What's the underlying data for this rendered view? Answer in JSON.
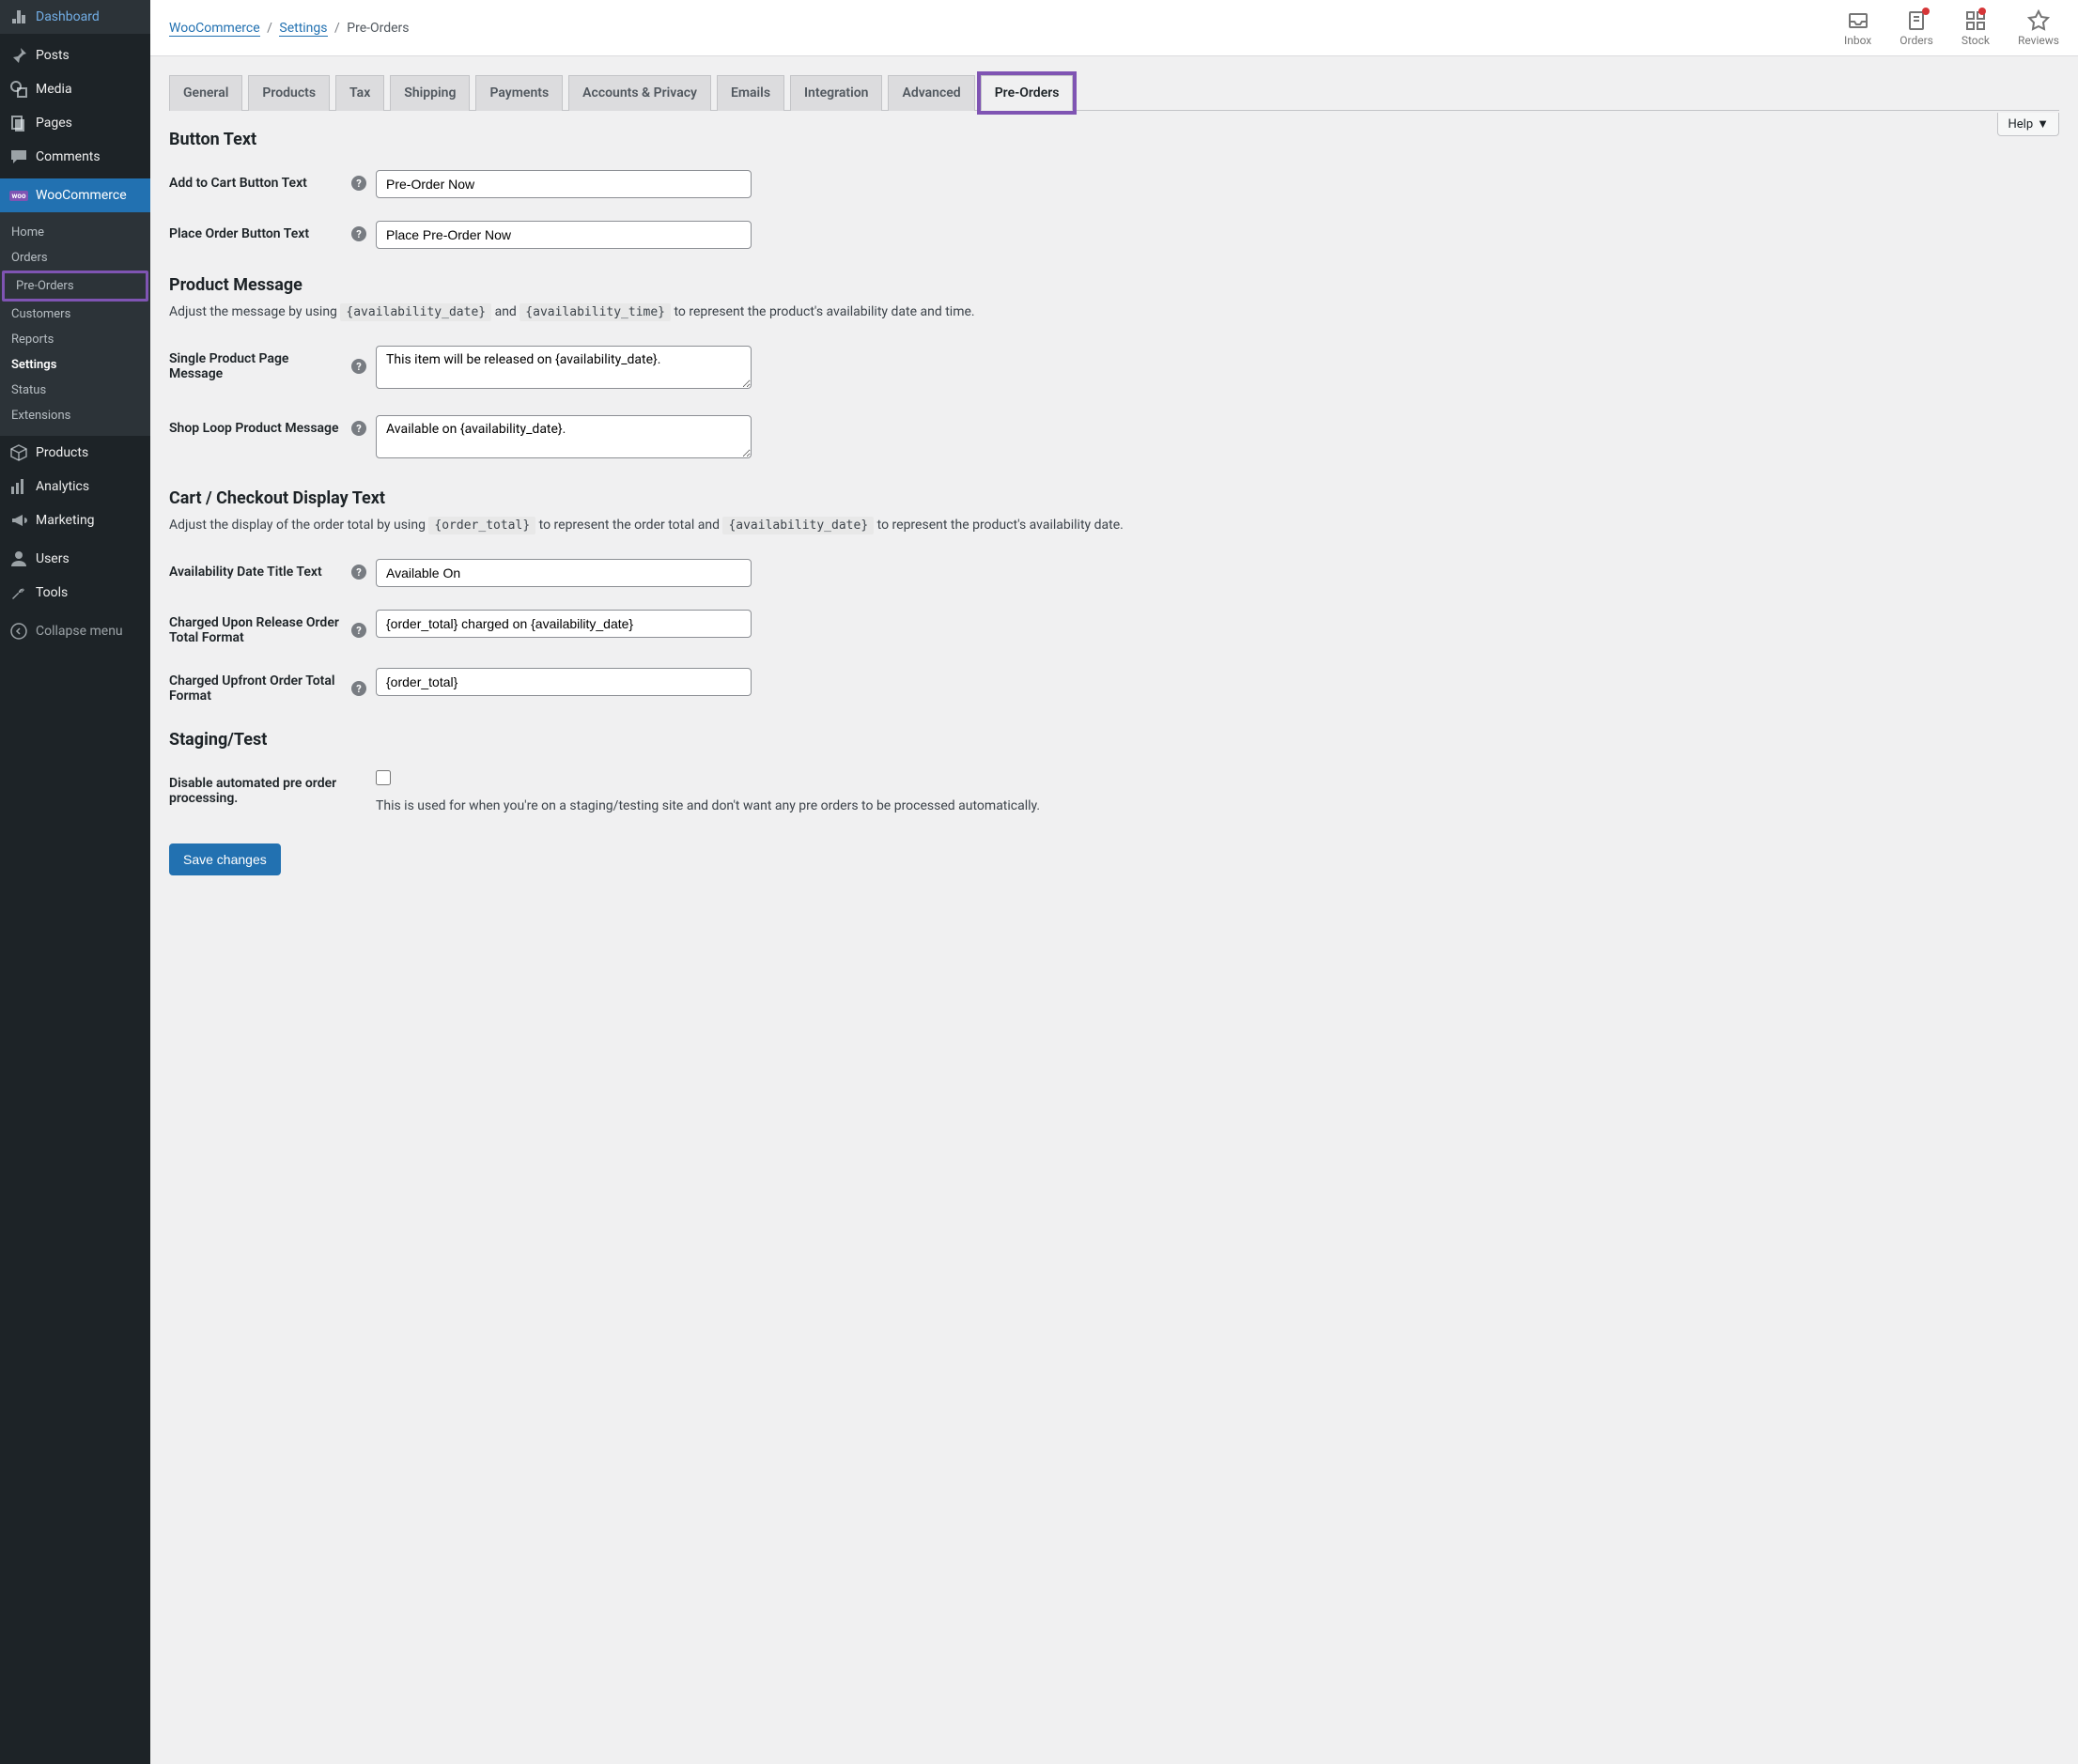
{
  "sidebar": {
    "items": [
      {
        "icon": "dashboard",
        "label": "Dashboard"
      },
      {
        "icon": "pin",
        "label": "Posts"
      },
      {
        "icon": "media",
        "label": "Media"
      },
      {
        "icon": "page",
        "label": "Pages"
      },
      {
        "icon": "comment",
        "label": "Comments"
      },
      {
        "icon": "woo",
        "label": "WooCommerce",
        "active": true
      },
      {
        "icon": "product",
        "label": "Products"
      },
      {
        "icon": "analytics",
        "label": "Analytics"
      },
      {
        "icon": "marketing",
        "label": "Marketing"
      },
      {
        "icon": "users",
        "label": "Users"
      },
      {
        "icon": "tools",
        "label": "Tools"
      },
      {
        "icon": "collapse",
        "label": "Collapse menu"
      }
    ],
    "submenu": [
      {
        "label": "Home"
      },
      {
        "label": "Orders"
      },
      {
        "label": "Pre-Orders",
        "highlighted": true
      },
      {
        "label": "Customers"
      },
      {
        "label": "Reports"
      },
      {
        "label": "Settings",
        "current": true
      },
      {
        "label": "Status"
      },
      {
        "label": "Extensions"
      }
    ]
  },
  "breadcrumb": {
    "a": "WooCommerce",
    "b": "Settings",
    "c": "Pre-Orders"
  },
  "topbar": {
    "inbox": "Inbox",
    "orders": "Orders",
    "stock": "Stock",
    "reviews": "Reviews",
    "help": "Help"
  },
  "tabs": [
    "General",
    "Products",
    "Tax",
    "Shipping",
    "Payments",
    "Accounts & Privacy",
    "Emails",
    "Integration",
    "Advanced",
    "Pre-Orders"
  ],
  "sections": {
    "button_text": {
      "heading": "Button Text"
    },
    "product_message": {
      "heading": "Product Message",
      "desc_pre": "Adjust the message by using ",
      "token1": "{availability_date}",
      "mid": " and ",
      "token2": "{availability_time}",
      "desc_post": " to represent the product's availability date and time."
    },
    "cart_checkout": {
      "heading": "Cart / Checkout Display Text",
      "desc_pre": "Adjust the display of the order total by using ",
      "token1": "{order_total}",
      "mid": " to represent the order total and ",
      "token2": "{availability_date}",
      "desc_post": " to represent the product's availability date."
    },
    "staging": {
      "heading": "Staging/Test"
    }
  },
  "fields": {
    "add_to_cart": {
      "label": "Add to Cart Button Text",
      "value": "Pre-Order Now"
    },
    "place_order": {
      "label": "Place Order Button Text",
      "value": "Place Pre-Order Now"
    },
    "single_product": {
      "label": "Single Product Page Message",
      "value": "This item will be released on {availability_date}."
    },
    "shop_loop": {
      "label": "Shop Loop Product Message",
      "value": "Available on {availability_date}."
    },
    "avail_title": {
      "label": "Availability Date Title Text",
      "value": "Available On"
    },
    "charged_release": {
      "label": "Charged Upon Release Order Total Format",
      "value": "{order_total} charged on {availability_date}"
    },
    "charged_upfront": {
      "label": "Charged Upfront Order Total Format",
      "value": "{order_total}"
    },
    "disable_auto": {
      "label": "Disable automated pre order processing.",
      "desc": "This is used for when you're on a staging/testing site and don't want any pre orders to be processed automatically."
    }
  },
  "save": "Save changes"
}
